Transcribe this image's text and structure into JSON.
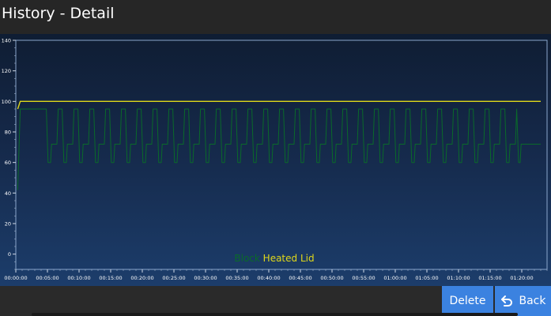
{
  "header": {
    "title": "History - Detail"
  },
  "buttons": {
    "delete_label": "Delete",
    "back_label": "Back"
  },
  "colors": {
    "block_series": "#0a6a2a",
    "lid_series": "#e0d81a",
    "button": "#3b82e0"
  },
  "icons": {
    "back": "back-arrow-icon"
  },
  "chart_data": {
    "type": "line",
    "title": "",
    "xlabel": "",
    "ylabel": "",
    "ylim": [
      -10,
      140
    ],
    "yticks": [
      0,
      20,
      40,
      60,
      80,
      100,
      120,
      140
    ],
    "xlim_minutes": [
      0,
      84
    ],
    "xtick_labels": [
      "00:00:00",
      "00:05:00",
      "00:10:00",
      "00:15:00",
      "00:20:00",
      "00:25:00",
      "00:30:00",
      "00:35:00",
      "00:40:00",
      "00:45:00",
      "00:50:00",
      "00:55:00",
      "01:00:00",
      "01:05:00",
      "01:10:00",
      "01:15:00",
      "01:20:00"
    ],
    "legend": {
      "position": "bottom-center",
      "entries": [
        "Block",
        "Heated Lid"
      ]
    },
    "grid": false,
    "series": [
      {
        "name": "Block",
        "color": "#0a6a2a",
        "initial_denaturation": {
          "start_min": 0.3,
          "end_min": 4.2,
          "temp": 95
        },
        "cycles": 30,
        "cycle_start_min": 4.2,
        "cycle_length_min": 2.5,
        "cycle_temps": {
          "denature": 95,
          "anneal": 60,
          "extend": 72
        },
        "start_temp": 42,
        "final_extension_temp": 72,
        "end_min": 83
      },
      {
        "name": "Heated Lid",
        "color": "#e0d81a",
        "start_temp": 95,
        "hold_temp": 100,
        "start_min": 0.3,
        "end_min": 83
      }
    ]
  }
}
